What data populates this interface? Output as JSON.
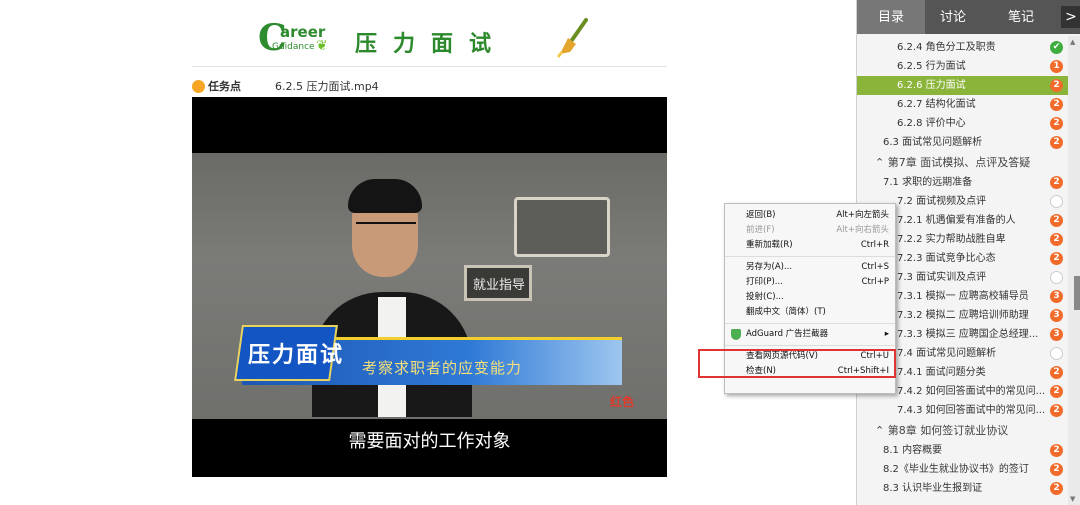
{
  "header": {
    "logo_c": "C",
    "logo_areer": "areer",
    "logo_guidance": "Guidance",
    "title": "压力面试"
  },
  "task": {
    "label": "任务点",
    "file": "6.2.5 压力面试.mp4"
  },
  "video": {
    "board_text": "就业指导",
    "badge_text": "压力面试",
    "caption": "考察求职者的应变能力",
    "tv_logo": "红色",
    "subtitle": "需要面对的工作对象"
  },
  "sidebar": {
    "tabs": [
      {
        "label": "目录",
        "active": true
      },
      {
        "label": "讨论",
        "active": false
      },
      {
        "label": "笔记",
        "active": false
      }
    ],
    "arrow": ">",
    "items": [
      {
        "text": "6.2.4 角色分工及职责",
        "indent": 40,
        "status": "done",
        "mark": "✔",
        "type": "item"
      },
      {
        "text": "6.2.5 行为面试",
        "indent": 40,
        "status": "pending",
        "mark": "1",
        "type": "item"
      },
      {
        "text": "6.2.6 压力面试",
        "indent": 40,
        "status": "pending",
        "mark": "2",
        "type": "active"
      },
      {
        "text": "6.2.7 结构化面试",
        "indent": 40,
        "status": "pending",
        "mark": "2",
        "type": "item"
      },
      {
        "text": "6.2.8 评价中心",
        "indent": 40,
        "status": "pending",
        "mark": "2",
        "type": "item"
      },
      {
        "text": "6.3 面试常见问题解析",
        "indent": 26,
        "status": "pending",
        "mark": "2",
        "type": "item"
      },
      {
        "text": "⌃  第7章 面试模拟、点评及答疑",
        "indent": 18,
        "status": "none",
        "mark": "",
        "type": "chapter"
      },
      {
        "text": "7.1 求职的远期准备",
        "indent": 26,
        "status": "pending",
        "mark": "2",
        "type": "item"
      },
      {
        "text": "7.2 面试视频及点评",
        "indent": 40,
        "status": "empty",
        "mark": "",
        "type": "item"
      },
      {
        "text": "7.2.1 机遇偏爱有准备的人",
        "indent": 40,
        "status": "pending",
        "mark": "2",
        "type": "item"
      },
      {
        "text": "7.2.2 实力帮助战胜自卑",
        "indent": 40,
        "status": "pending",
        "mark": "2",
        "type": "item"
      },
      {
        "text": "7.2.3 面试竞争比心态",
        "indent": 40,
        "status": "pending",
        "mark": "2",
        "type": "item"
      },
      {
        "text": "7.3 面试实训及点评",
        "indent": 40,
        "status": "empty",
        "mark": "",
        "type": "item"
      },
      {
        "text": "7.3.1 模拟一 应聘高校辅导员",
        "indent": 40,
        "status": "pending",
        "mark": "3",
        "type": "item"
      },
      {
        "text": "7.3.2 模拟二 应聘培训师助理",
        "indent": 40,
        "status": "pending",
        "mark": "3",
        "type": "item"
      },
      {
        "text": "7.3.3 模拟三 应聘国企总经理...",
        "indent": 40,
        "status": "pending",
        "mark": "3",
        "type": "item"
      },
      {
        "text": "7.4 面试常见问题解析",
        "indent": 40,
        "status": "empty",
        "mark": "",
        "type": "item"
      },
      {
        "text": "7.4.1 面试问题分类",
        "indent": 40,
        "status": "pending",
        "mark": "2",
        "type": "item"
      },
      {
        "text": "7.4.2 如何回答面试中的常见问...",
        "indent": 40,
        "status": "pending",
        "mark": "2",
        "type": "item"
      },
      {
        "text": "7.4.3 如何回答面试中的常见问...",
        "indent": 40,
        "status": "pending",
        "mark": "2",
        "type": "item"
      },
      {
        "text": "⌃  第8章 如何签订就业协议",
        "indent": 18,
        "status": "none",
        "mark": "",
        "type": "chapter"
      },
      {
        "text": "8.1 内容概要",
        "indent": 26,
        "status": "pending",
        "mark": "2",
        "type": "item"
      },
      {
        "text": "8.2《毕业生就业协议书》的签订",
        "indent": 26,
        "status": "pending",
        "mark": "2",
        "type": "item"
      },
      {
        "text": "8.3 认识毕业生报到证",
        "indent": 26,
        "status": "pending",
        "mark": "2",
        "type": "item"
      }
    ]
  },
  "context_menu": {
    "groups": [
      [
        {
          "label": "返回(B)",
          "shortcut": "Alt+向左箭头",
          "disabled": false
        },
        {
          "label": "前进(F)",
          "shortcut": "Alt+向右箭头",
          "disabled": true
        },
        {
          "label": "重新加载(R)",
          "shortcut": "Ctrl+R",
          "disabled": false
        }
      ],
      [
        {
          "label": "另存为(A)...",
          "shortcut": "Ctrl+S",
          "disabled": false
        },
        {
          "label": "打印(P)...",
          "shortcut": "Ctrl+P",
          "disabled": false
        },
        {
          "label": "投射(C)...",
          "shortcut": "",
          "disabled": false
        },
        {
          "label": "翻成中文（简体）(T)",
          "shortcut": "",
          "disabled": false
        }
      ],
      [
        {
          "label": "AdGuard 广告拦截器",
          "shortcut": "▸",
          "disabled": false,
          "icon": "adguard-shield-icon"
        }
      ],
      [
        {
          "label": "查看网页源代码(V)",
          "shortcut": "Ctrl+U",
          "disabled": false
        },
        {
          "label": "检查(N)",
          "shortcut": "Ctrl+Shift+I",
          "disabled": false
        }
      ]
    ]
  },
  "colors": {
    "active_item": "#8bb43a",
    "pending_badge": "#f26b2b",
    "done_badge": "#3fae3f",
    "highlight_box": "#e23333"
  }
}
